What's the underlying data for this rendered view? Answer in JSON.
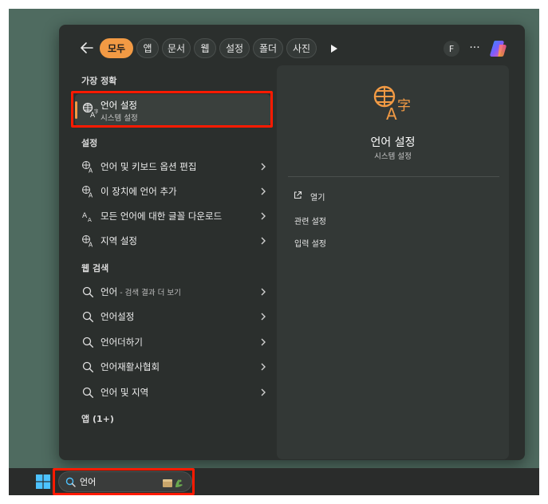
{
  "filters": {
    "back_label": "뒤로",
    "chips": [
      {
        "label": "모두",
        "active": true
      },
      {
        "label": "앱"
      },
      {
        "label": "문서"
      },
      {
        "label": "웹"
      },
      {
        "label": "설정"
      },
      {
        "label": "폴더"
      },
      {
        "label": "사진"
      }
    ],
    "profile_letter": "F",
    "more_label": "···"
  },
  "best_match": {
    "section_title": "가장 정확",
    "title": "언어 설정",
    "subtitle": "시스템 설정",
    "icon": "language-settings-icon"
  },
  "settings": {
    "section_title": "설정",
    "items": [
      {
        "label": "언어 및 키보드 옵션 편집",
        "icon": "language-settings-icon"
      },
      {
        "label": "이 장치에 언어 추가",
        "icon": "language-settings-icon"
      },
      {
        "label": "모든 언어에 대한 글꼴 다운로드",
        "icon": "font-icon"
      },
      {
        "label": "지역 설정",
        "icon": "language-settings-icon"
      }
    ]
  },
  "web_search": {
    "section_title": "웹 검색",
    "items": [
      {
        "label": "언어",
        "suffix": " - 검색 결과 더 보기",
        "icon": "search-icon"
      },
      {
        "label": "언어설정",
        "icon": "search-icon"
      },
      {
        "label": "언어더하기",
        "icon": "search-icon"
      },
      {
        "label": "언어재활사협회",
        "icon": "search-icon"
      },
      {
        "label": "언어 및 지역",
        "icon": "search-icon"
      }
    ]
  },
  "apps": {
    "section_title": "앱 (1+)"
  },
  "preview": {
    "title": "언어 설정",
    "subtitle": "시스템 설정",
    "open_label": "열기",
    "related_label": "관련 설정",
    "input_settings_label": "입력 설정"
  },
  "taskbar": {
    "search_value": "언어"
  },
  "colors": {
    "accent": "#f29a44",
    "highlight_box": "#ff1a00",
    "desktop": "#4f6b60",
    "panel": "#2b2f2d"
  }
}
